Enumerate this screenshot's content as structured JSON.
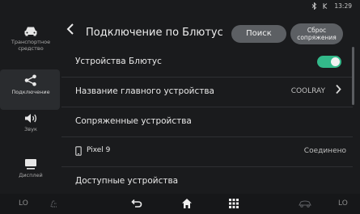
{
  "status": {
    "time": "13:29"
  },
  "sidebar": {
    "items": [
      {
        "label": "Транспортное средство",
        "icon": "car-icon"
      },
      {
        "label": "Подключение",
        "icon": "share-icon",
        "active": true
      },
      {
        "label": "Звук",
        "icon": "speaker-icon"
      },
      {
        "label": "Дисплей",
        "icon": "monitor-icon"
      }
    ]
  },
  "header": {
    "title": "Подключение по Блютус",
    "search_label": "Поиск",
    "reset_label_1": "Сброс",
    "reset_label_2": "сопряжения"
  },
  "rows": [
    {
      "label": "Устройства Блютус",
      "toggle": true
    },
    {
      "label": "Название главного устройства",
      "value": "COOLRAY"
    },
    {
      "label": "Сопряженные устройства"
    },
    {
      "label": "Pixel 9",
      "value": "Соединено"
    },
    {
      "label": "Доступные устройства"
    }
  ],
  "bottom": {
    "left_temp": "LO",
    "right_temp": "LO"
  },
  "colors": {
    "accent": "#33b98a",
    "background": "#1a1b1d",
    "button": "#5c5f63"
  }
}
